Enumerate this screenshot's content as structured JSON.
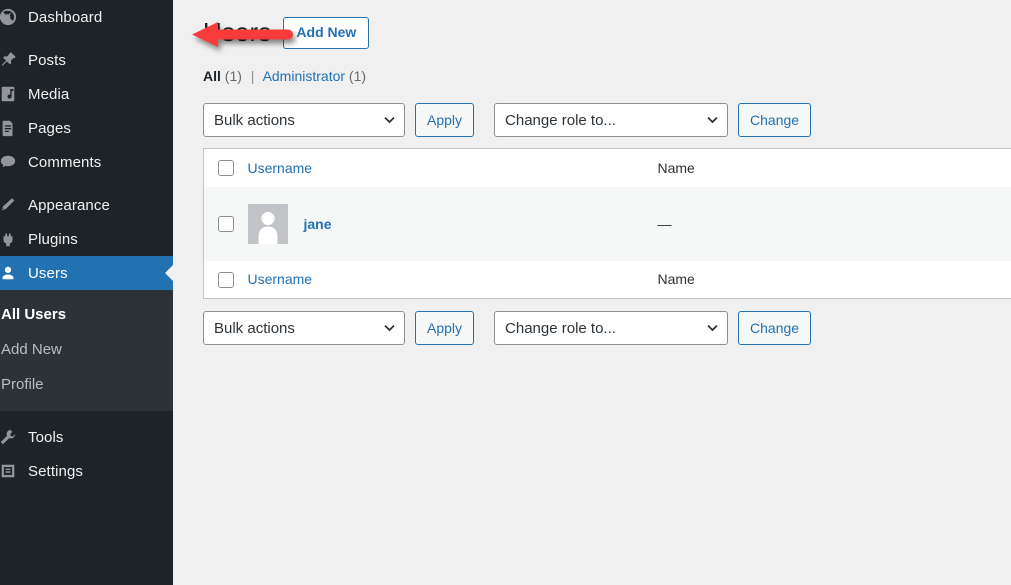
{
  "sidebar": {
    "items": [
      {
        "label": "Dashboard",
        "icon": "dashboard-icon",
        "current": false
      },
      {
        "label": "Posts",
        "icon": "pin-icon",
        "current": false
      },
      {
        "label": "Media",
        "icon": "media-icon",
        "current": false
      },
      {
        "label": "Pages",
        "icon": "page-icon",
        "current": false
      },
      {
        "label": "Comments",
        "icon": "comments-icon",
        "current": false
      },
      {
        "label": "Appearance",
        "icon": "appearance-icon",
        "current": false
      },
      {
        "label": "Plugins",
        "icon": "plugins-icon",
        "current": false
      },
      {
        "label": "Users",
        "icon": "users-icon",
        "current": true
      },
      {
        "label": "Tools",
        "icon": "tools-icon",
        "current": false
      },
      {
        "label": "Settings",
        "icon": "settings-icon",
        "current": false
      }
    ],
    "submenu": [
      {
        "label": "All Users",
        "current": true
      },
      {
        "label": "Add New",
        "current": false
      },
      {
        "label": "Profile",
        "current": false
      }
    ]
  },
  "page": {
    "title": "Users",
    "add_new_label": "Add New"
  },
  "filters": {
    "all_label": "All",
    "all_count": "(1)",
    "separator": "|",
    "role_label": "Administrator",
    "role_count": "(1)"
  },
  "tablenav": {
    "bulk_actions_value": "Bulk actions",
    "apply_label": "Apply",
    "change_role_value": "Change role to...",
    "change_label": "Change"
  },
  "table": {
    "columns": {
      "username": "Username",
      "name": "Name"
    },
    "rows": [
      {
        "username": "jane",
        "name": "—"
      }
    ]
  },
  "annotation": {
    "type": "arrow",
    "direction": "left",
    "color": "#f93b3b",
    "points_at": "Add New"
  }
}
